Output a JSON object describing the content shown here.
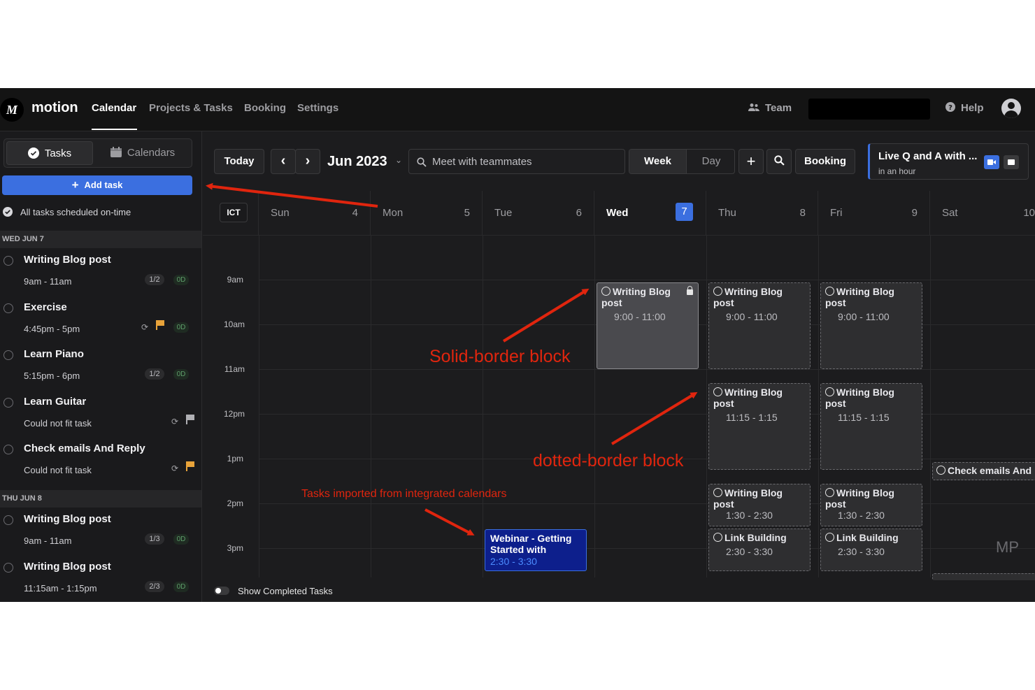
{
  "app": {
    "brand": "motion",
    "nav": [
      "Calendar",
      "Projects & Tasks",
      "Booking",
      "Settings"
    ],
    "team": "Team",
    "help": "Help"
  },
  "sidebar": {
    "tabs": [
      "Tasks",
      "Calendars"
    ],
    "add_task": "Add task",
    "status": "All tasks scheduled on-time",
    "groups": [
      {
        "header": "WED JUN 7",
        "tasks": [
          {
            "title": "Writing Blog post",
            "time": "9am - 11am",
            "chunks": "1/2",
            "badge": "0D"
          },
          {
            "title": "Exercise",
            "time": "4:45pm - 5pm",
            "badge": "0D"
          },
          {
            "title": "Learn Piano",
            "time": "5:15pm - 6pm",
            "chunks": "1/2",
            "badge": "0D"
          },
          {
            "title": "Learn Guitar",
            "time": "Could not fit task"
          },
          {
            "title": "Check emails And Reply",
            "time": "Could not fit task"
          }
        ]
      },
      {
        "header": "THU JUN 8",
        "tasks": [
          {
            "title": "Writing Blog post",
            "time": "9am - 11am",
            "chunks": "1/3",
            "badge": "0D"
          },
          {
            "title": "Writing Blog post",
            "time": "11:15am - 1:15pm",
            "chunks": "2/3",
            "badge": "0D"
          }
        ]
      }
    ],
    "flag_colors": {
      "orange": "#e8a33a",
      "gray": "#b0b0b4"
    }
  },
  "toolbar": {
    "today": "Today",
    "prev": "‹",
    "next": "›",
    "month": "Jun 2023",
    "search_value": "Meet with teammates",
    "views": [
      "Week",
      "Day"
    ],
    "add": "+",
    "booking": "Booking",
    "live": {
      "title": "Live Q and A with ...",
      "subtitle": "in an hour"
    }
  },
  "calendar": {
    "timezone": "ICT",
    "days": [
      {
        "name": "Sun",
        "num": "4"
      },
      {
        "name": "Mon",
        "num": "5"
      },
      {
        "name": "Tue",
        "num": "6"
      },
      {
        "name": "Wed",
        "num": "7",
        "today": true
      },
      {
        "name": "Thu",
        "num": "8"
      },
      {
        "name": "Fri",
        "num": "9"
      },
      {
        "name": "Sat",
        "num": "10"
      }
    ],
    "hours": [
      "9am",
      "10am",
      "11am",
      "12pm",
      "1pm",
      "2pm",
      "3pm"
    ],
    "events": {
      "wed1": {
        "title": "Writing Blog post",
        "time": "9:00 - 11:00"
      },
      "thu1": {
        "title": "Writing Blog post",
        "time": "9:00 - 11:00"
      },
      "fri1": {
        "title": "Writing Blog post",
        "time": "9:00 - 11:00"
      },
      "thu2": {
        "title": "Writing Blog post",
        "time": "11:15 - 1:15"
      },
      "fri2": {
        "title": "Writing Blog post",
        "time": "11:15 - 1:15"
      },
      "thu3": {
        "title": "Writing Blog post",
        "time": "1:30 - 2:30"
      },
      "fri3": {
        "title": "Writing Blog post",
        "time": "1:30 - 2:30"
      },
      "thu4": {
        "title": "Link Building",
        "time": "2:30 - 3:30"
      },
      "fri4": {
        "title": "Link Building",
        "time": "2:30 - 3:30"
      },
      "sat1": {
        "title": "Check emails And"
      },
      "tue1": {
        "title": "Webinar - Getting Started with",
        "time": "2:30 - 3:30"
      }
    },
    "watermark": "MP",
    "show_completed": "Show Completed Tasks"
  },
  "annotations": {
    "solid": "Solid-border block",
    "dotted": "dotted-border block",
    "imported": "Tasks imported from integrated calendars",
    "color": "#e0250e"
  }
}
